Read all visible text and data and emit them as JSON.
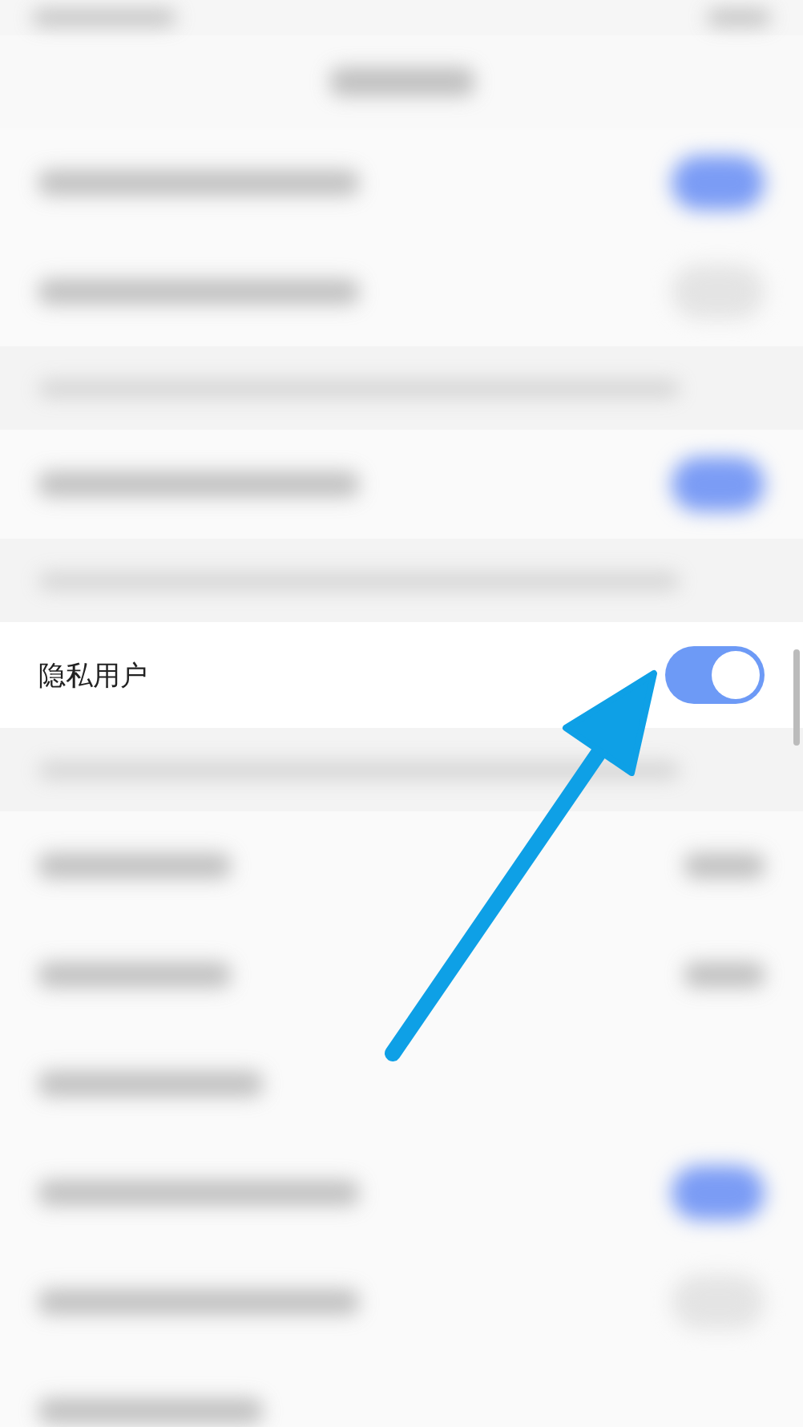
{
  "rows_before": [
    {
      "kind": "toggle",
      "on": true
    },
    {
      "kind": "toggle",
      "on": false
    },
    {
      "kind": "note"
    },
    {
      "kind": "toggle",
      "on": true
    },
    {
      "kind": "note"
    }
  ],
  "privacy_row": {
    "label": "隐私用户",
    "on": true
  },
  "rows_after": [
    {
      "kind": "note"
    },
    {
      "kind": "value"
    },
    {
      "kind": "value"
    },
    {
      "kind": "plain"
    },
    {
      "kind": "toggle",
      "on": true
    },
    {
      "kind": "toggle",
      "on": false
    },
    {
      "kind": "plain"
    }
  ]
}
